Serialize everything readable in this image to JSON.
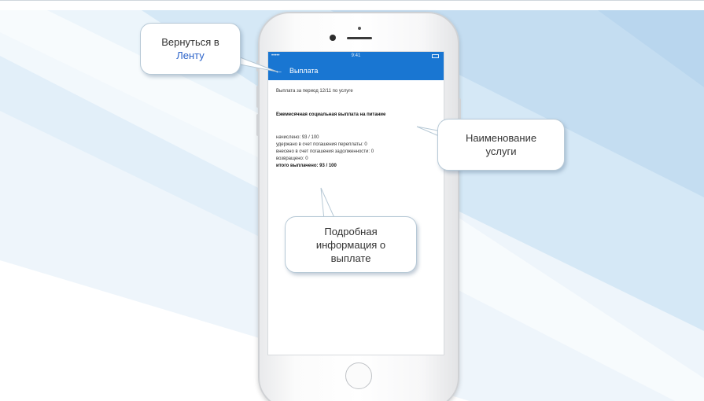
{
  "phone": {
    "status_bar": {
      "carrier": "•••••",
      "time": "9:41"
    },
    "app_bar": {
      "back_icon": "←",
      "title": "Выплата"
    },
    "content": {
      "notice": "Выплата за период 12/11 по услуге",
      "service_name": "Ежемесячная социальная выплата на питание",
      "details": [
        "начислено: 93 / 100",
        "удержано в счет погашения переплаты: 0",
        "внесено в счет погашения задолженности: 0",
        "возвращено: 0"
      ],
      "total": "итого выплачено: 93 / 100"
    }
  },
  "callouts": {
    "back_line1": "Вернуться в",
    "back_link": "Ленту",
    "service_line1": "Наименование",
    "service_line2": "услуги",
    "payment_line1": "Подробная",
    "payment_line2": "информация о",
    "payment_line3": "выплате"
  },
  "colors": {
    "app_bar": "#1976d2",
    "link": "#2a62c9",
    "background_stripes": "#c9e1f3"
  },
  "icons": {
    "back": "left-arrow-icon",
    "home": "home-button-icon"
  }
}
